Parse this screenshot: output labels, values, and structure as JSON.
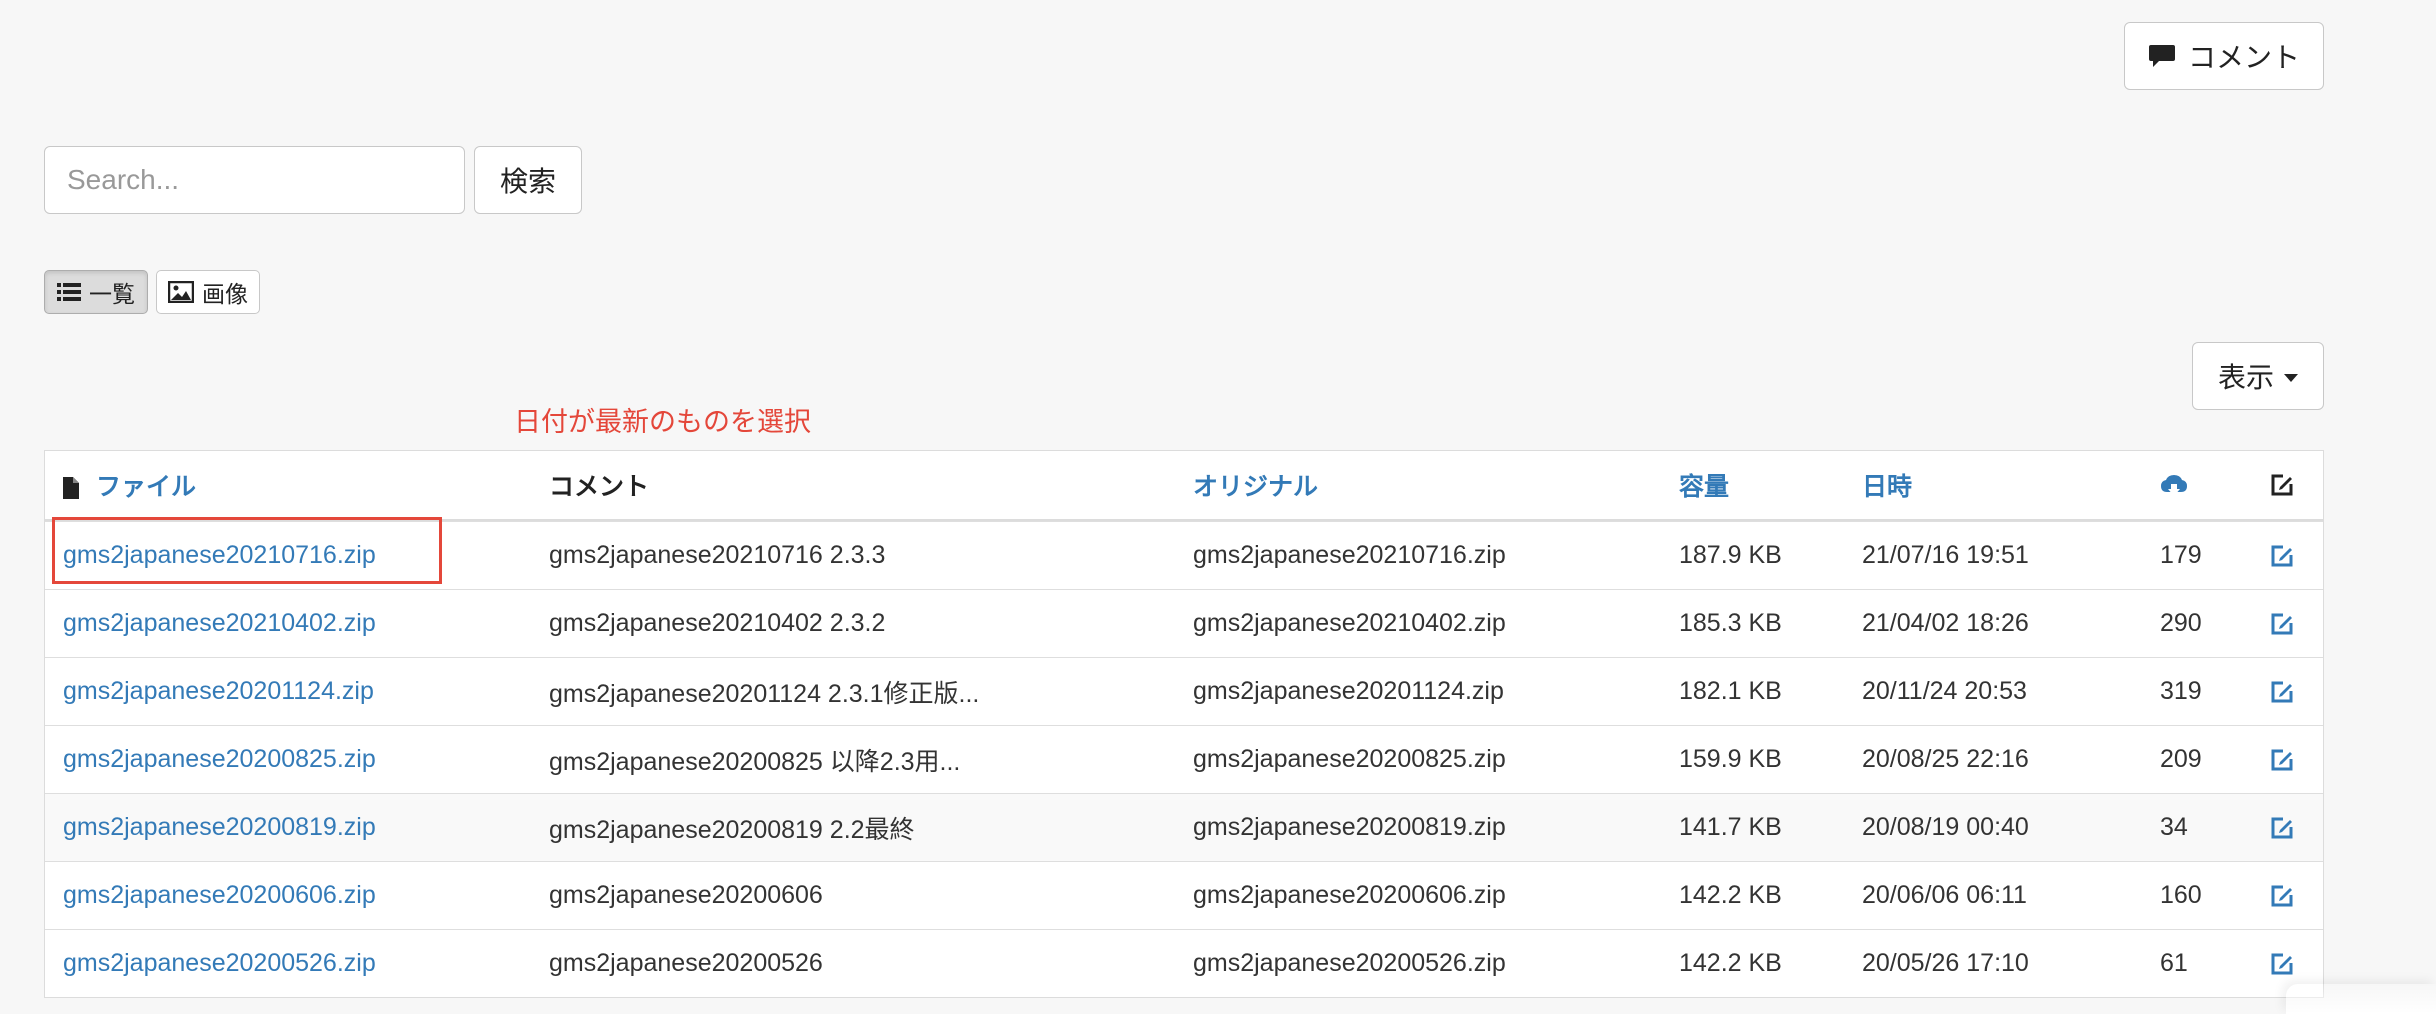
{
  "toolbar": {
    "comment_button": "コメント",
    "search_placeholder": "Search...",
    "search_button": "検索",
    "view_list": "一覧",
    "view_image": "画像",
    "display_button": "表示"
  },
  "annotation": "日付が最新のものを選択",
  "table": {
    "headers": {
      "file": "ファイル",
      "comment": "コメント",
      "original": "オリジナル",
      "size": "容量",
      "date": "日時",
      "downloads_icon": "cloud-download-icon",
      "edit_icon": "edit-icon"
    },
    "rows": [
      {
        "file": "gms2japanese20210716.zip",
        "comment": "gms2japanese20210716 2.3.3",
        "original": "gms2japanese20210716.zip",
        "size": "187.9 KB",
        "date": "21/07/16 19:51",
        "downloads": "179"
      },
      {
        "file": "gms2japanese20210402.zip",
        "comment": "gms2japanese20210402 2.3.2",
        "original": "gms2japanese20210402.zip",
        "size": "185.3 KB",
        "date": "21/04/02 18:26",
        "downloads": "290"
      },
      {
        "file": "gms2japanese20201124.zip",
        "comment": "gms2japanese20201124 2.3.1修正版...",
        "original": "gms2japanese20201124.zip",
        "size": "182.1 KB",
        "date": "20/11/24 20:53",
        "downloads": "319"
      },
      {
        "file": "gms2japanese20200825.zip",
        "comment": "gms2japanese20200825 以降2.3用...",
        "original": "gms2japanese20200825.zip",
        "size": "159.9 KB",
        "date": "20/08/25 22:16",
        "downloads": "209"
      },
      {
        "file": "gms2japanese20200819.zip",
        "comment": "gms2japanese20200819 2.2最終",
        "original": "gms2japanese20200819.zip",
        "size": "141.7 KB",
        "date": "20/08/19 00:40",
        "downloads": "34"
      },
      {
        "file": "gms2japanese20200606.zip",
        "comment": "gms2japanese20200606",
        "original": "gms2japanese20200606.zip",
        "size": "142.2 KB",
        "date": "20/06/06 06:11",
        "downloads": "160"
      },
      {
        "file": "gms2japanese20200526.zip",
        "comment": "gms2japanese20200526",
        "original": "gms2japanese20200526.zip",
        "size": "142.2 KB",
        "date": "20/05/26 17:10",
        "downloads": "61"
      }
    ]
  },
  "colors": {
    "link": "#337ab7",
    "annotation": "#e4473a",
    "background": "#f7f7f7"
  }
}
